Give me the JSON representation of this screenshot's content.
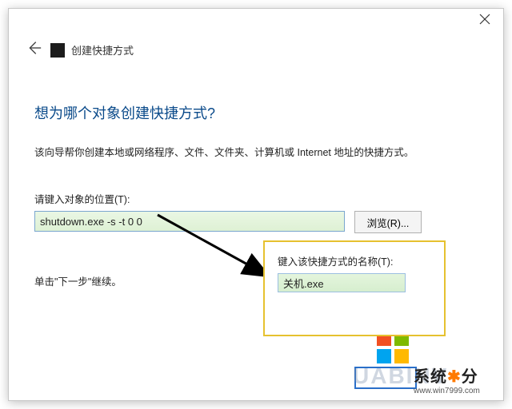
{
  "window": {
    "title": "创建快捷方式",
    "close_tooltip": "关闭"
  },
  "wizard": {
    "heading": "想为哪个对象创建快捷方式?",
    "description": "该向导帮你创建本地或网络程序、文件、文件夹、计算机或 Internet 地址的快捷方式。",
    "location_label": "请键入对象的位置(T):",
    "location_value": "shutdown.exe -s -t 0 0",
    "browse_label": "浏览(R)...",
    "continue_hint": "单击\"下一步\"继续。"
  },
  "annotation": {
    "name_label": "键入该快捷方式的名称(T):",
    "name_value": "关机.exe"
  },
  "branding": {
    "site_name_a": "系统",
    "site_name_b": "分",
    "site_url": "www.win7999.com",
    "ghost": "UABINV"
  }
}
